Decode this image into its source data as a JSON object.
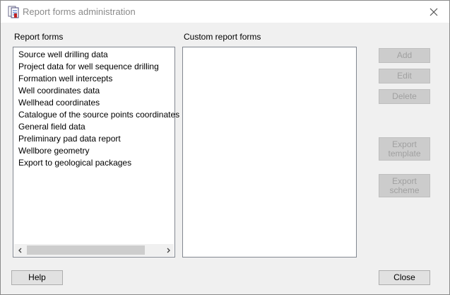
{
  "window": {
    "title": "Report forms administration"
  },
  "report_forms": {
    "label": "Report forms",
    "items": [
      "Source well drilling data",
      "Project data for well sequence drilling",
      "Formation well intercepts",
      "Well coordinates data",
      "Wellhead coordinates",
      "Catalogue of the source points coordinates",
      "General field data",
      "Preliminary pad data report",
      "Wellbore geometry",
      "Export to geological packages"
    ]
  },
  "custom_report_forms": {
    "label": "Custom report forms"
  },
  "buttons": {
    "add": "Add",
    "edit": "Edit",
    "delete": "Delete",
    "export_template_line1": "Export",
    "export_template_line2": "template",
    "export_scheme_line1": "Export",
    "export_scheme_line2": "scheme",
    "help": "Help",
    "close": "Close"
  },
  "icons": {
    "app": "report-forms-icon",
    "close": "close-icon",
    "scroll_left": "chevron-left-icon",
    "scroll_right": "chevron-right-icon"
  }
}
